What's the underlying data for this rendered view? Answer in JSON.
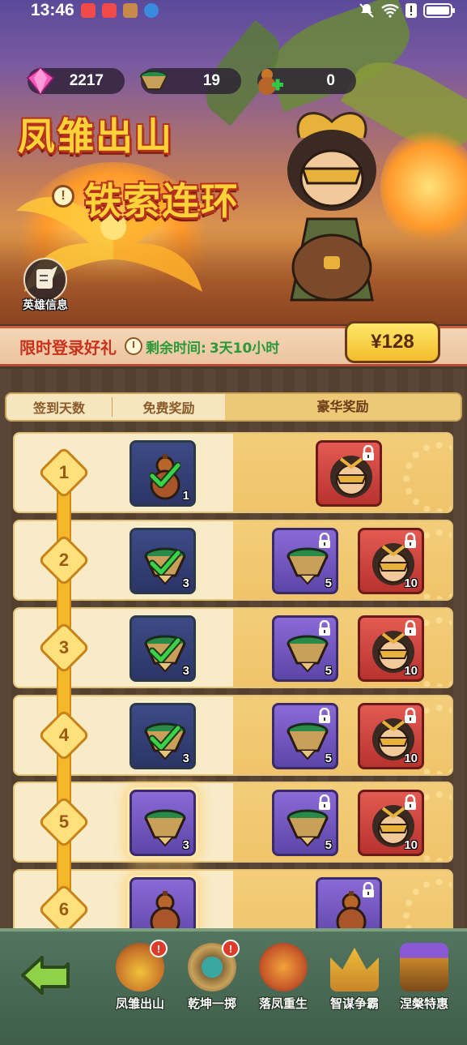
{
  "status_bar": {
    "time": "13:46"
  },
  "currencies": [
    {
      "name": "gem",
      "value": "2217"
    },
    {
      "name": "bowl",
      "value": "19"
    },
    {
      "name": "gourd",
      "value": "0"
    }
  ],
  "banner": {
    "title_line1": "凤雏出山",
    "title_line2": "铁索连环",
    "info_symbol": "!",
    "hero_info_label": "英雄信息"
  },
  "limited_offer": {
    "title": "限时登录好礼",
    "remaining_label": "剩余时间:",
    "remaining_value": "3天10小时",
    "price": "¥128"
  },
  "table_header": {
    "days": "签到天数",
    "free": "免费奖励",
    "luxury": "豪华奖励"
  },
  "rows": [
    {
      "day": "1",
      "free": {
        "item": "gourd",
        "qty": "1",
        "claimed": true
      },
      "luxury": [
        {
          "item": "hero-portrait",
          "qty": "",
          "locked": true
        }
      ]
    },
    {
      "day": "2",
      "free": {
        "item": "bowl",
        "qty": "3",
        "claimed": true
      },
      "luxury": [
        {
          "item": "bowl",
          "qty": "5",
          "locked": true
        },
        {
          "item": "hero-portrait",
          "qty": "10",
          "locked": true
        }
      ]
    },
    {
      "day": "3",
      "free": {
        "item": "bowl",
        "qty": "3",
        "claimed": true
      },
      "luxury": [
        {
          "item": "bowl",
          "qty": "5",
          "locked": true
        },
        {
          "item": "hero-portrait",
          "qty": "10",
          "locked": true
        }
      ]
    },
    {
      "day": "4",
      "free": {
        "item": "bowl",
        "qty": "3",
        "claimed": true
      },
      "luxury": [
        {
          "item": "bowl",
          "qty": "5",
          "locked": true
        },
        {
          "item": "hero-portrait",
          "qty": "10",
          "locked": true
        }
      ]
    },
    {
      "day": "5",
      "free": {
        "item": "bowl",
        "qty": "3",
        "claimed": false
      },
      "luxury": [
        {
          "item": "bowl",
          "qty": "5",
          "locked": true
        },
        {
          "item": "hero-portrait",
          "qty": "10",
          "locked": true
        }
      ]
    },
    {
      "day": "6",
      "free": {
        "item": "gourd",
        "qty": "",
        "claimed": false
      },
      "luxury": [
        {
          "item": "gourd",
          "qty": "",
          "locked": true
        }
      ]
    }
  ],
  "bottom_nav": {
    "items": [
      {
        "label": "凤雏出山",
        "badge": "!"
      },
      {
        "label": "乾坤一掷",
        "badge": "!"
      },
      {
        "label": "落凤重生",
        "badge": ""
      },
      {
        "label": "智谋争霸",
        "badge": ""
      },
      {
        "label": "涅槃特惠",
        "badge": ""
      }
    ]
  },
  "colors": {
    "accent_gold": "#f5b82a",
    "title_yellow": "#ffd23a",
    "price_button": "#f2bd2a",
    "remaining_green": "#2a9a3a",
    "limit_red": "#c8321c"
  }
}
